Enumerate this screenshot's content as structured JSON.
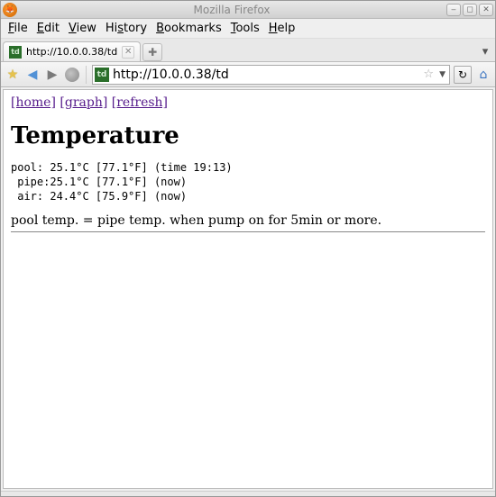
{
  "window": {
    "title": "Mozilla Firefox"
  },
  "menubar": {
    "file": "File",
    "edit": "Edit",
    "view": "View",
    "history": "History",
    "bookmarks": "Bookmarks",
    "tools": "Tools",
    "help": "Help"
  },
  "tab": {
    "title": "http://10.0.0.38/td"
  },
  "urlbar": {
    "value": "http://10.0.0.38/td"
  },
  "page": {
    "links": {
      "home": "[home]",
      "graph": "[graph]",
      "refresh": "[refresh]"
    },
    "heading": "Temperature",
    "readings_text": "pool: 25.1°C [77.1°F] (time 19:13)\n pipe:25.1°C [77.1°F] (now)\n air: 24.4°C [75.9°F] (now)",
    "readings": [
      {
        "label": "pool",
        "celsius": 25.1,
        "fahrenheit": 77.1,
        "meta": "time 19:13"
      },
      {
        "label": "pipe",
        "celsius": 25.1,
        "fahrenheit": 77.1,
        "meta": "now"
      },
      {
        "label": "air",
        "celsius": 24.4,
        "fahrenheit": 75.9,
        "meta": "now"
      }
    ],
    "note": "pool temp. = pipe temp. when pump on for 5min or more."
  }
}
